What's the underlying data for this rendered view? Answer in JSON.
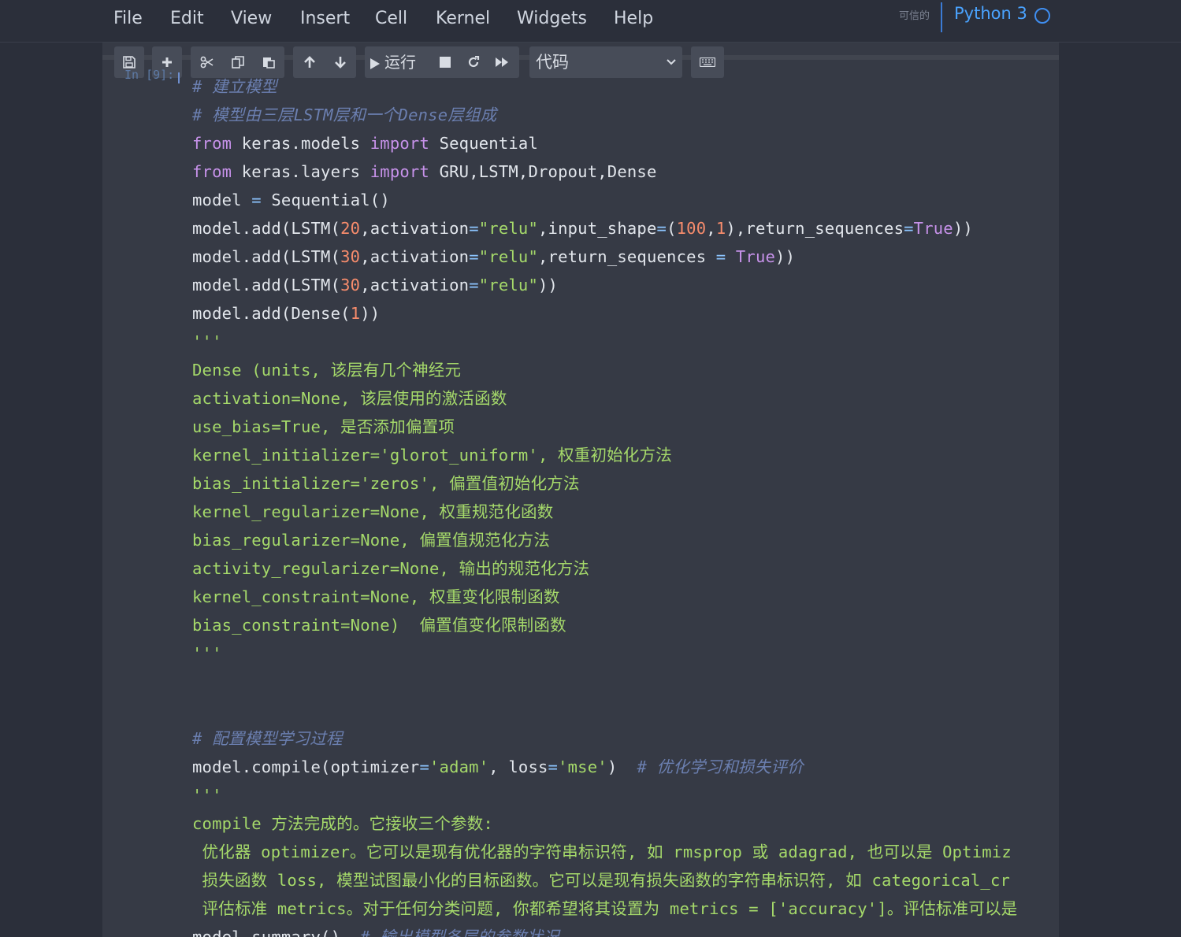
{
  "menubar": {
    "items": [
      "File",
      "Edit",
      "View",
      "Insert",
      "Cell",
      "Kernel",
      "Widgets",
      "Help"
    ],
    "trusted": "可信的",
    "kernel_name": "Python 3"
  },
  "toolbar": {
    "run_label": "运行",
    "cell_type": "代码"
  },
  "cell": {
    "prompt": "In [9]:"
  },
  "code": {
    "l1": "# 建立模型",
    "l2": "# 模型由三层LSTM层和一个Dense层组成",
    "l3_kw1": "from",
    "l3_mod": " keras.models ",
    "l3_kw2": "import",
    "l3_rest": " Sequential",
    "l4_kw1": "from",
    "l4_mod": " keras.layers ",
    "l4_kw2": "import",
    "l4_rest": " GRU,LSTM,Dropout,Dense",
    "l5_a": "model ",
    "l5_op": "=",
    "l5_b": " Sequential()",
    "l6_a": "model.add(LSTM(",
    "l6_n1": "20",
    "l6_b": ",activation",
    "l6_op1": "=",
    "l6_s1": "\"relu\"",
    "l6_c": ",input_shape",
    "l6_op2": "=",
    "l6_d": "(",
    "l6_n2": "100",
    "l6_e": ",",
    "l6_n3": "1",
    "l6_f": "),return_sequences",
    "l6_op3": "=",
    "l6_t": "True",
    "l6_g": "))",
    "l7_a": "model.add(LSTM(",
    "l7_n1": "30",
    "l7_b": ",activation",
    "l7_op1": "=",
    "l7_s1": "\"relu\"",
    "l7_c": ",return_sequences ",
    "l7_op2": "=",
    "l7_t": " True",
    "l7_d": "))",
    "l8_a": "model.add(LSTM(",
    "l8_n1": "30",
    "l8_b": ",activation",
    "l8_op1": "=",
    "l8_s1": "\"relu\"",
    "l8_c": "))",
    "l9_a": "model.add(Dense(",
    "l9_n1": "1",
    "l9_b": "))",
    "l10": "'''",
    "l11": "Dense (units, 该层有几个神经元",
    "l12": "activation=None, 该层使用的激活函数",
    "l13": "use_bias=True, 是否添加偏置项",
    "l14": "kernel_initializer='glorot_uniform', 权重初始化方法",
    "l15": "bias_initializer='zeros', 偏置值初始化方法",
    "l16": "kernel_regularizer=None, 权重规范化函数",
    "l17": "bias_regularizer=None, 偏置值规范化方法",
    "l18": "activity_regularizer=None, 输出的规范化方法",
    "l19": "kernel_constraint=None, 权重变化限制函数",
    "l20": "bias_constraint=None)  偏置值变化限制函数",
    "l21": "'''",
    "l22": "",
    "l23": "",
    "l24": "# 配置模型学习过程",
    "l25_a": "model.compile(optimizer",
    "l25_op1": "=",
    "l25_s1": "'adam'",
    "l25_b": ", loss",
    "l25_op2": "=",
    "l25_s2": "'mse'",
    "l25_c": ")  ",
    "l25_cm": "# 优化学习和损失评价",
    "l26": "'''",
    "l27": "compile 方法完成的。它接收三个参数:",
    "l28": " 优化器 optimizer。它可以是现有优化器的字符串标识符, 如 rmsprop 或 adagrad, 也可以是 Optimiz",
    "l29": " 损失函数 loss, 模型试图最小化的目标函数。它可以是现有损失函数的字符串标识符, 如 categorical_cr",
    "l30": " 评估标准 metrics。对于任何分类问题, 你都希望将其设置为 metrics = ['accuracy']。评估标准可以是",
    "l31_a": "model.summary()  ",
    "l31_cm": "# 输出模型各层的参数状况"
  }
}
